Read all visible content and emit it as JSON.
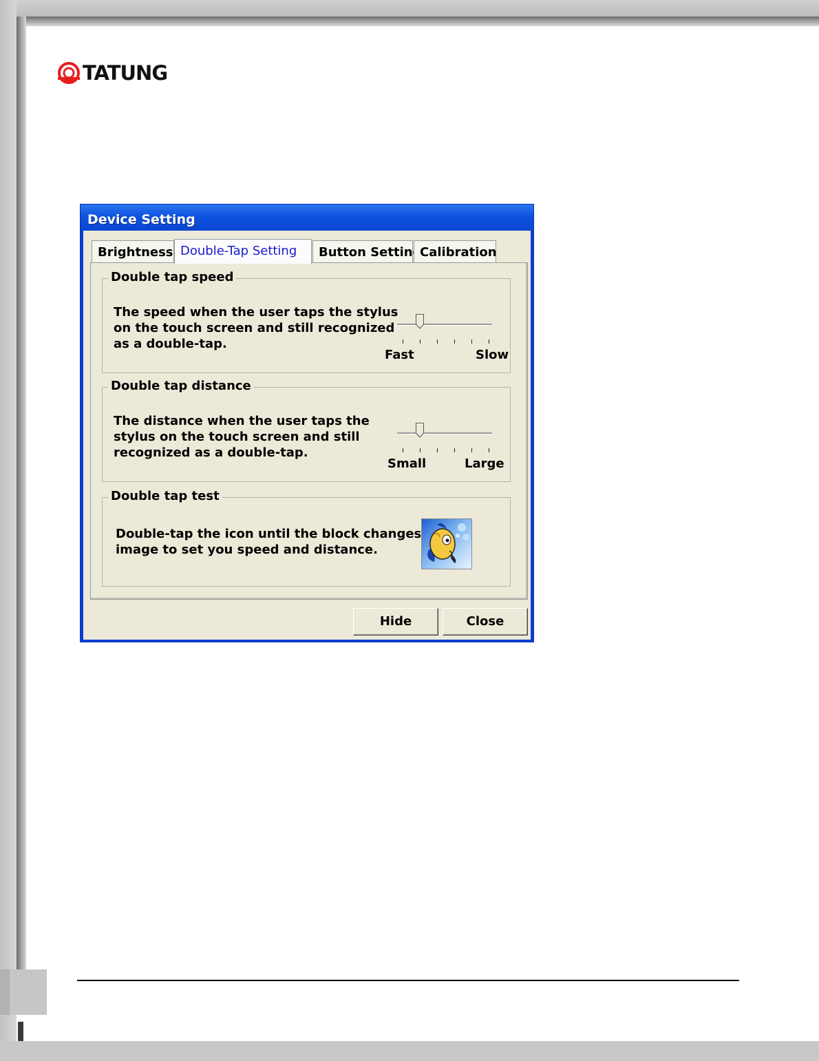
{
  "logo": {
    "text": "TATUNG",
    "color": "#e61e1e"
  },
  "window": {
    "title": "Device Setting",
    "tabs": [
      {
        "label": "Brightness"
      },
      {
        "label": "Double-Tap Setting",
        "active": true
      },
      {
        "label": "Button Setting"
      },
      {
        "label": "Calibration"
      }
    ],
    "speed": {
      "legend": "Double tap speed",
      "description": "The speed when the user taps the stylus\non the touch screen and still recognized\nas a double-tap.",
      "min_label": "Fast",
      "max_label": "Slow",
      "tick_count": 6,
      "value": 1
    },
    "distance": {
      "legend": "Double tap distance",
      "description": "The distance when the user taps the\nstylus on the touch screen and still\nrecognized as a double-tap.",
      "min_label": "Small",
      "max_label": "Large",
      "tick_count": 6,
      "value": 1
    },
    "test": {
      "legend": "Double tap test",
      "description": "Double-tap the icon until the block changes\nimage to set you speed and distance.",
      "icon": "fish-icon"
    },
    "buttons": {
      "hide": "Hide",
      "close": "Close"
    }
  },
  "colors": {
    "titlebar": "#0a46d2",
    "dialog_bg": "#ece9d8",
    "active_tab_text": "#1a1acc"
  }
}
